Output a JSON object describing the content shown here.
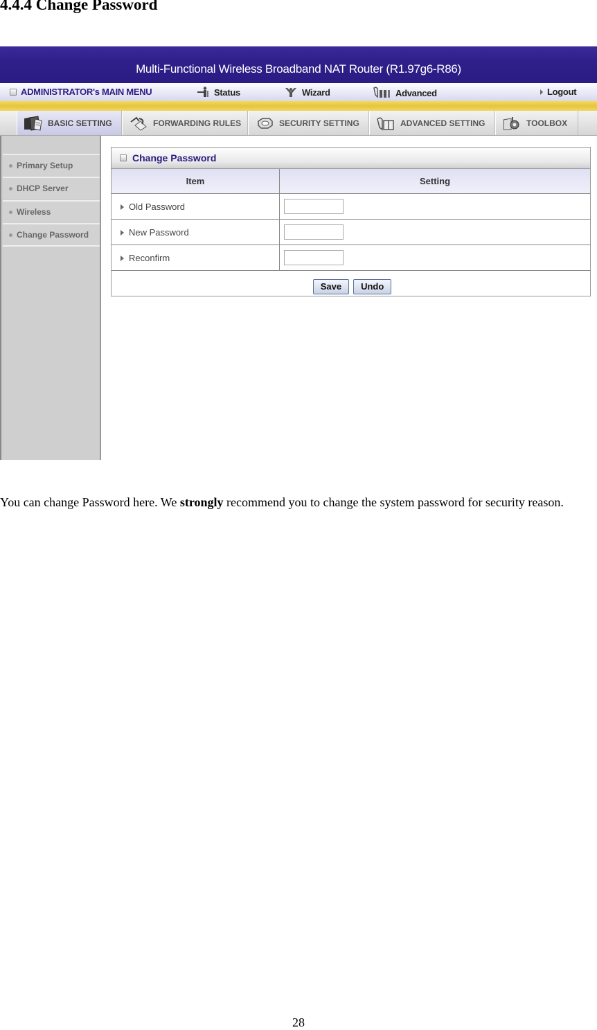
{
  "document": {
    "heading": "4.4.4 Change Password",
    "paragraph": {
      "before": "You can change Password here. We ",
      "emphasis": "strongly",
      "after": " recommend you to change the system password for security reason."
    },
    "page_number": "28"
  },
  "router_ui": {
    "banner_title": "Multi-Functional Wireless Broadband NAT Router (R1.97g6-R86)",
    "main_menu": {
      "admin_label": "ADMINISTRATOR's MAIN MENU",
      "items": [
        {
          "label": "Status",
          "icon": "status-icon"
        },
        {
          "label": "Wizard",
          "icon": "wizard-icon"
        },
        {
          "label": "Advanced",
          "icon": "advanced-icon"
        },
        {
          "label": "Logout",
          "icon": "arrow-right-icon"
        }
      ]
    },
    "tabs": [
      {
        "label": "BASIC SETTING",
        "icon": "folder-icon",
        "active": true
      },
      {
        "label": "FORWARDING RULES",
        "icon": "forwarding-icon",
        "active": false
      },
      {
        "label": "SECURITY SETTING",
        "icon": "security-icon",
        "active": false
      },
      {
        "label": "ADVANCED SETTING",
        "icon": "advanced-setting-icon",
        "active": false
      },
      {
        "label": "TOOLBOX",
        "icon": "toolbox-icon",
        "active": false
      }
    ],
    "sidebar": [
      {
        "label": "Primary Setup"
      },
      {
        "label": "DHCP Server"
      },
      {
        "label": "Wireless"
      },
      {
        "label": "Change Password"
      }
    ],
    "panel": {
      "title": "Change Password",
      "columns": [
        "Item",
        "Setting"
      ],
      "rows": [
        {
          "label": "Old Password",
          "value": ""
        },
        {
          "label": "New Password",
          "value": ""
        },
        {
          "label": "Reconfirm",
          "value": ""
        }
      ],
      "save_label": "Save",
      "undo_label": "Undo"
    },
    "colors": {
      "banner": "#2e1f8a",
      "accent_gold": "#e8c43c",
      "sidebar_bg": "#cfcfcf"
    }
  }
}
